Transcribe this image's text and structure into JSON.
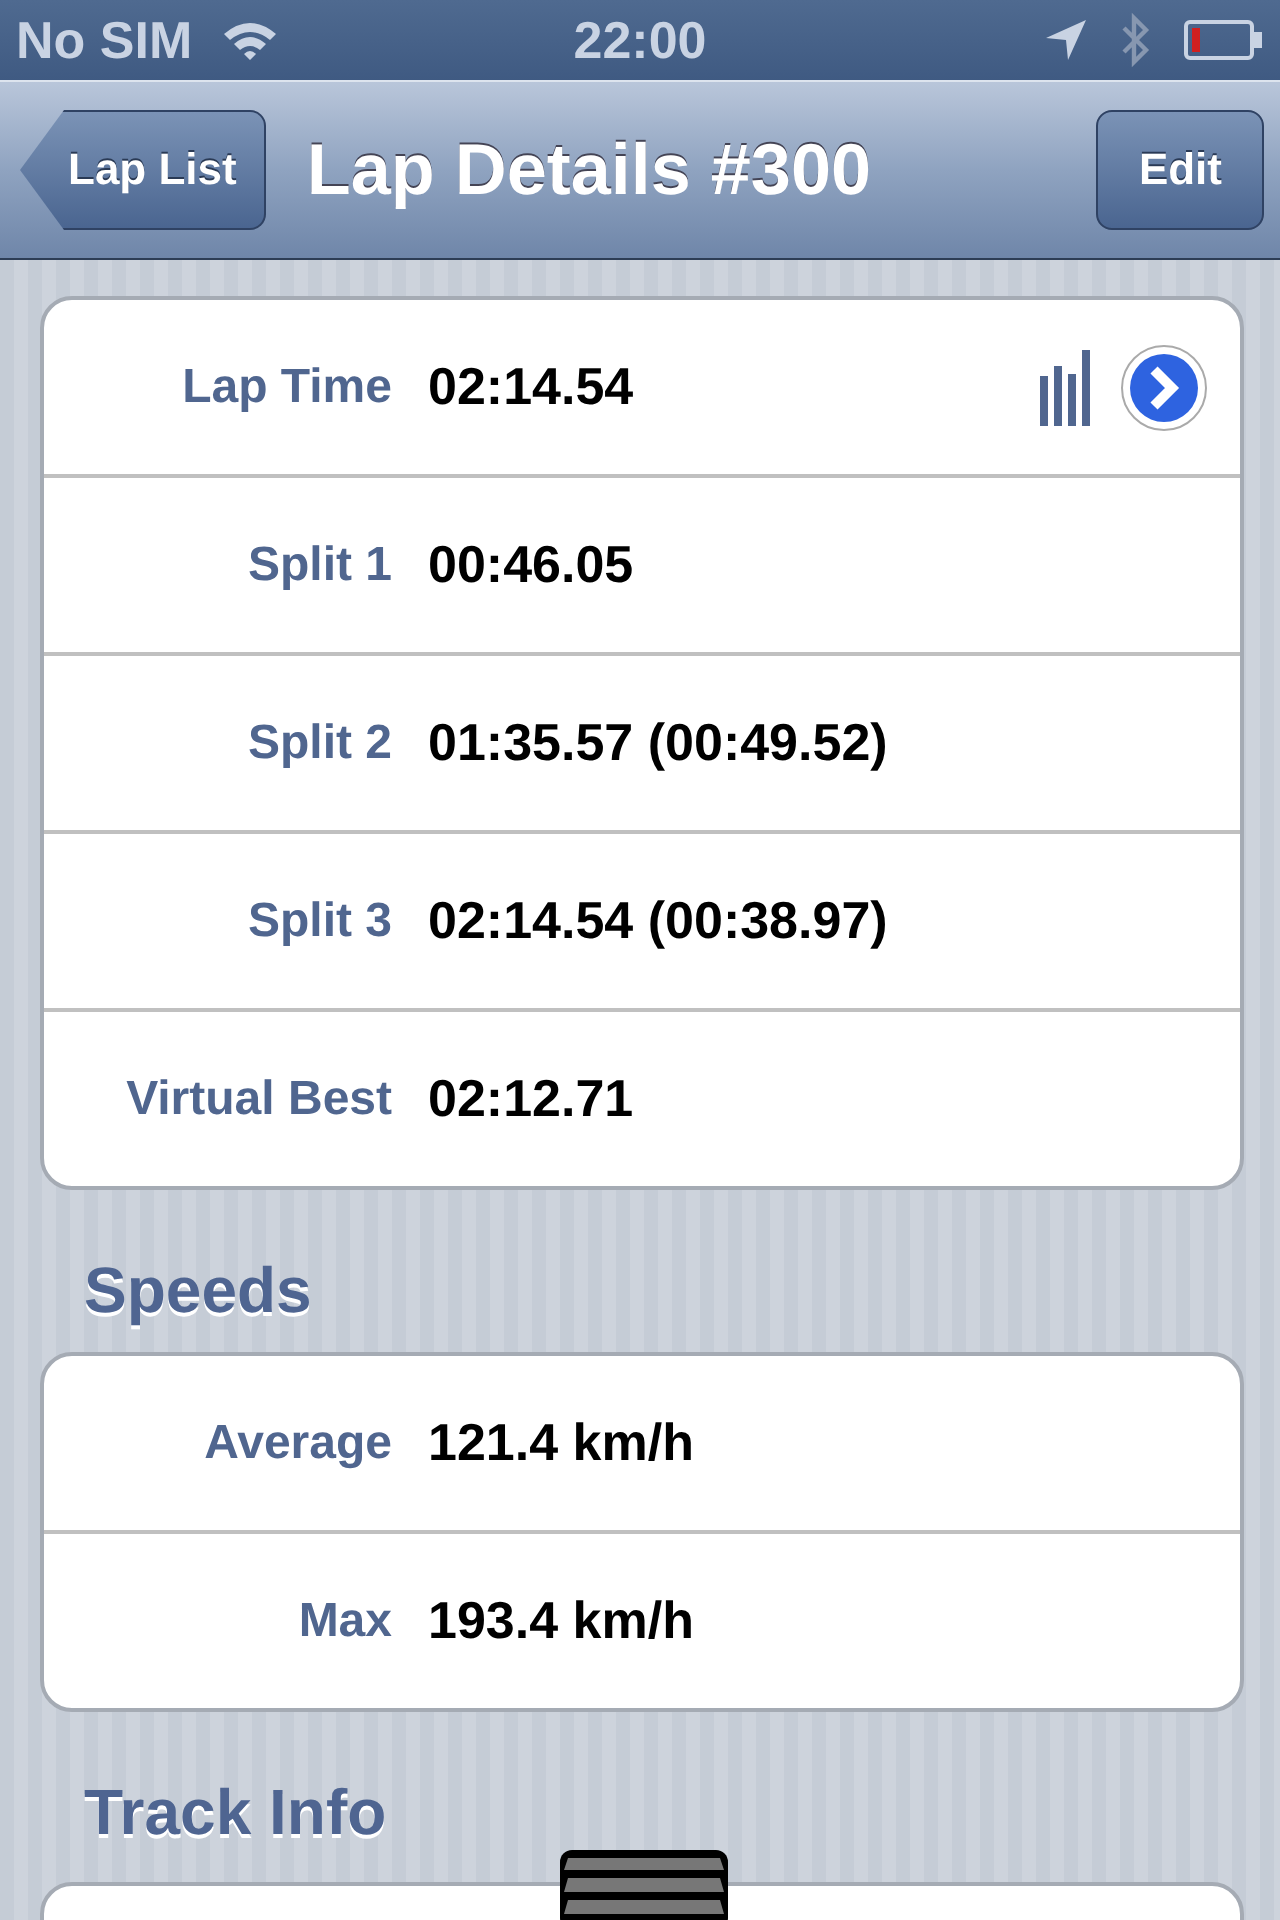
{
  "status_bar": {
    "carrier": "No SIM",
    "time": "22:00"
  },
  "nav_bar": {
    "back": "Lap List",
    "title": "Lap Details #300",
    "action": "Edit"
  },
  "sections": [
    {
      "rows": [
        {
          "label": "Lap Time",
          "value": "02:14.54",
          "kind": "chart"
        },
        {
          "label": "Split 1",
          "value": "00:46.05",
          "kind": "plain"
        },
        {
          "label": "Split 2",
          "value": "01:35.57 (00:49.52)",
          "kind": "plain"
        },
        {
          "label": "Split 3",
          "value": "02:14.54 (00:38.97)",
          "kind": "plain"
        },
        {
          "label": "Virtual Best",
          "value": "02:12.71",
          "kind": "plain"
        }
      ]
    },
    {
      "header": "Speeds",
      "rows": [
        {
          "label": "Average",
          "value": "121.4 km/h",
          "kind": "plain"
        },
        {
          "label": "Max",
          "value": "193.4 km/h",
          "kind": "plain"
        }
      ]
    },
    {
      "header": "Track Info"
    }
  ]
}
